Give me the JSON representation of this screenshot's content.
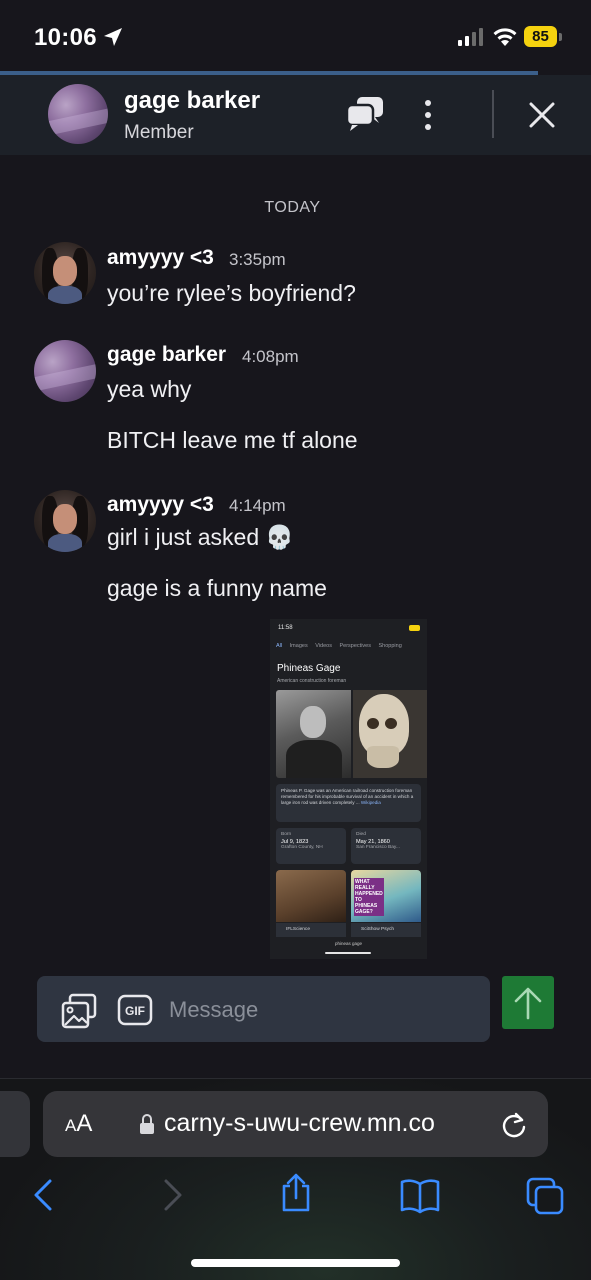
{
  "status_bar": {
    "time": "10:06",
    "battery": "85"
  },
  "chat_header": {
    "name": "gage barker",
    "role": "Member"
  },
  "day_divider": "TODAY",
  "messages": [
    {
      "author": "amyyyy <3",
      "time": "3:35pm",
      "lines": [
        "you’re rylee’s boyfriend?"
      ]
    },
    {
      "author": "gage barker",
      "time": "4:08pm",
      "lines": [
        "yea why",
        "BITCH leave me tf alone"
      ]
    },
    {
      "author": "amyyyy <3",
      "time": "4:14pm",
      "lines": [
        "girl i just asked",
        "gage is a funny name"
      ],
      "emoji": "💀"
    }
  ],
  "attachment": {
    "status_time": "11:58",
    "tabs": [
      "All",
      "Images",
      "Videos",
      "Perspectives",
      "Shopping"
    ],
    "title": "Phineas Gage",
    "subtitle": "American construction foreman",
    "description": "Phineas P. Gage was an American railroad construction foreman remembered for his improbable survival of an accident in which a large iron rod was driven completely ...",
    "wiki": "Wikipedia",
    "born_label": "Born",
    "born_date": "Jul 9, 1823",
    "born_place": "Grafton County, NH",
    "died_label": "Died",
    "died_date": "May 21, 1860",
    "died_place": "San Francisco Bay...",
    "thumb2_caption": "WHAT REALLY HAPPENED TO PHINEAS GAGE?",
    "source1": "IFLScience",
    "source2": "SciShow Psych",
    "search_url": "phineas gage"
  },
  "composer": {
    "placeholder": "Message",
    "gif_label": "GIF"
  },
  "safari": {
    "aa_small": "A",
    "aa_large": "A",
    "url": "carny-s-uwu-crew.mn.co"
  }
}
